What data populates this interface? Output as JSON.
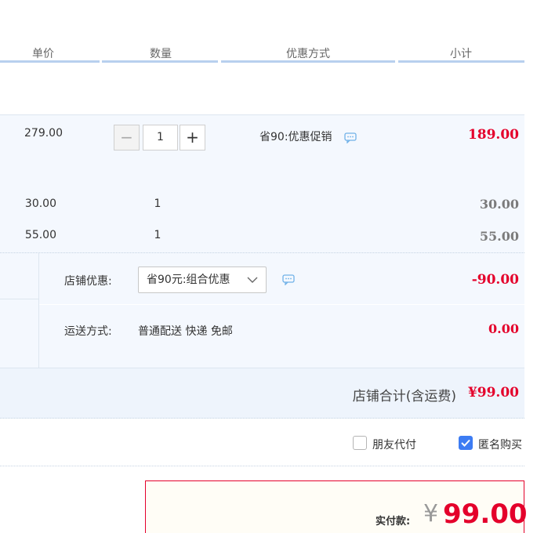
{
  "headers": {
    "unit_price": "单价",
    "quantity": "数量",
    "promo": "优惠方式",
    "subtotal": "小计"
  },
  "main_item": {
    "unit_price": "279.00",
    "quantity": "1",
    "minus": "−",
    "plus": "+",
    "promo": "省90:优惠促销",
    "subtotal": "189.00"
  },
  "combo_items": [
    {
      "unit_price": "30.00",
      "quantity": "1",
      "subtotal": "30.00"
    },
    {
      "unit_price": "55.00",
      "quantity": "1",
      "subtotal": "55.00"
    }
  ],
  "shop_discount": {
    "label": "店铺优惠:",
    "selected": "省90元:组合优惠",
    "amount": "-90.00"
  },
  "shipping": {
    "label": "运送方式:",
    "value": "普通配送 快递 免邮",
    "amount": "0.00"
  },
  "shop_total": {
    "label": "店铺合计(含运费)",
    "amount": "¥99.00"
  },
  "options": {
    "friend_pay": {
      "label": "朋友代付",
      "checked": false
    },
    "anonymous": {
      "label": "匿名购买",
      "checked": true
    }
  },
  "payment": {
    "label": "实付款:",
    "currency": "¥",
    "amount": "99.00"
  },
  "colors": {
    "accent_red": "#e4002b",
    "accent_blue": "#3d7cf3"
  }
}
